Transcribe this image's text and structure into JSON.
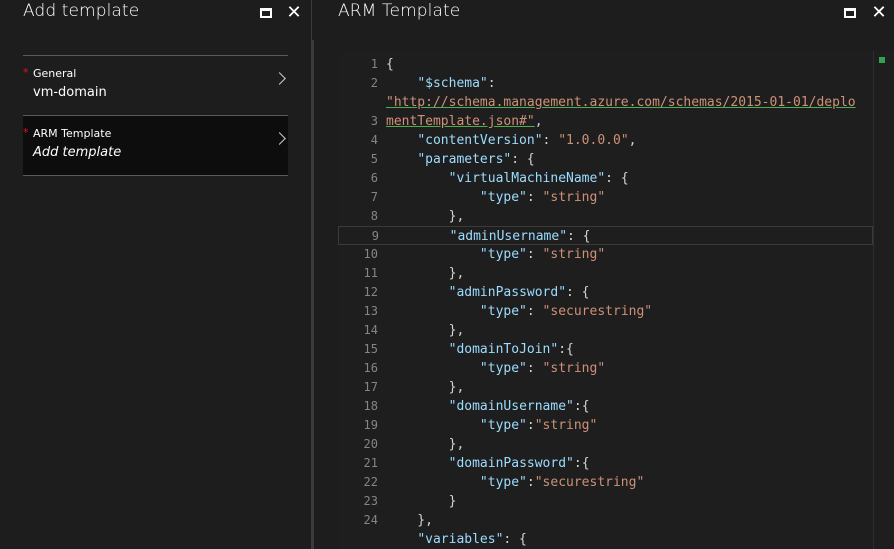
{
  "left_blade": {
    "title": "Add template",
    "steps": [
      {
        "required": "*",
        "label": "General",
        "value": "vm-domain"
      },
      {
        "required": "*",
        "label": "ARM Template",
        "value": "Add template"
      }
    ]
  },
  "right_blade": {
    "title": "ARM Template"
  },
  "controls": {
    "maximize_icon": "maximize-icon",
    "close_icon": "close-icon",
    "close_glyph": "✕"
  },
  "editor": {
    "line_numbers": [
      "1",
      "2",
      "",
      "3",
      "4",
      "5",
      "6",
      "7",
      "8",
      "9",
      "10",
      "11",
      "12",
      "13",
      "14",
      "15",
      "16",
      "17",
      "18",
      "19",
      "20",
      "21",
      "22",
      "23",
      "24"
    ],
    "lines": [
      "{",
      "    \"$schema\": ",
      "\"http://schema.management.azure.com/schemas/2015-01-01/deplo",
      "mentTemplate.json#\",",
      "    \"contentVersion\": \"1.0.0.0\",",
      "    \"parameters\": {",
      "        \"virtualMachineName\": {",
      "            \"type\": \"string\"",
      "        },",
      "        \"adminUsername\": {",
      "            \"type\": \"string\"",
      "        },",
      "        \"adminPassword\": {",
      "            \"type\": \"securestring\"",
      "        },",
      "        \"domainToJoin\":{",
      "            \"type\": \"string\"",
      "        },",
      "        \"domainUsername\":{",
      "            \"type\":\"string\"",
      "        },",
      "        \"domainPassword\":{",
      "            \"type\":\"securestring\"",
      "        }",
      "    },",
      "    \"variables\": {"
    ]
  },
  "colors": {
    "background": "#1d1d1d",
    "editor_bg": "#1e1e1e",
    "key": "#9cdcfe",
    "string": "#ce9178",
    "required": "#e81123",
    "scroll_mark": "#2ea44f"
  }
}
